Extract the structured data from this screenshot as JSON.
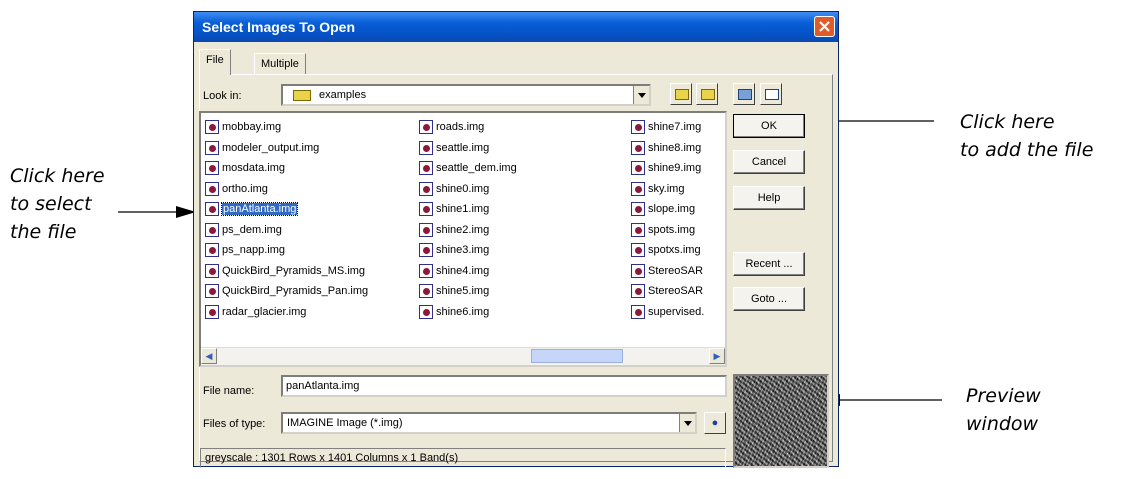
{
  "dialog": {
    "title": "Select Images To Open",
    "tabs": [
      "File",
      "Multiple"
    ],
    "look_in": {
      "label": "Look in:",
      "value": "examples"
    },
    "files": [
      [
        "mobbay.img",
        "modeler_output.img",
        "mosdata.img",
        "ortho.img",
        "panAtlanta.img",
        "ps_dem.img",
        "ps_napp.img",
        "QuickBird_Pyramids_MS.img",
        "QuickBird_Pyramids_Pan.img",
        "radar_glacier.img"
      ],
      [
        "roads.img",
        "seattle.img",
        "seattle_dem.img",
        "shine0.img",
        "shine1.img",
        "shine2.img",
        "shine3.img",
        "shine4.img",
        "shine5.img",
        "shine6.img"
      ],
      [
        "shine7.img",
        "shine8.img",
        "shine9.img",
        "sky.img",
        "slope.img",
        "spots.img",
        "spotxs.img",
        "StereoSAR",
        "StereoSAR",
        "supervised."
      ]
    ],
    "selected_file": "panAtlanta.img",
    "buttons": {
      "ok": "OK",
      "cancel": "Cancel",
      "help": "Help",
      "recent": "Recent ...",
      "goto": "Goto ..."
    },
    "file_name": {
      "label": "File name:",
      "value": "panAtlanta.img"
    },
    "files_of_type": {
      "label": "Files of type:",
      "value": "IMAGINE Image (*.img)"
    },
    "status": "greyscale : 1301 Rows x 1401 Columns x 1 Band(s)"
  },
  "callouts": {
    "select": "Click here\nto select\nthe file",
    "add": "Click here\nto add the file",
    "preview": "Preview\nwindow"
  }
}
